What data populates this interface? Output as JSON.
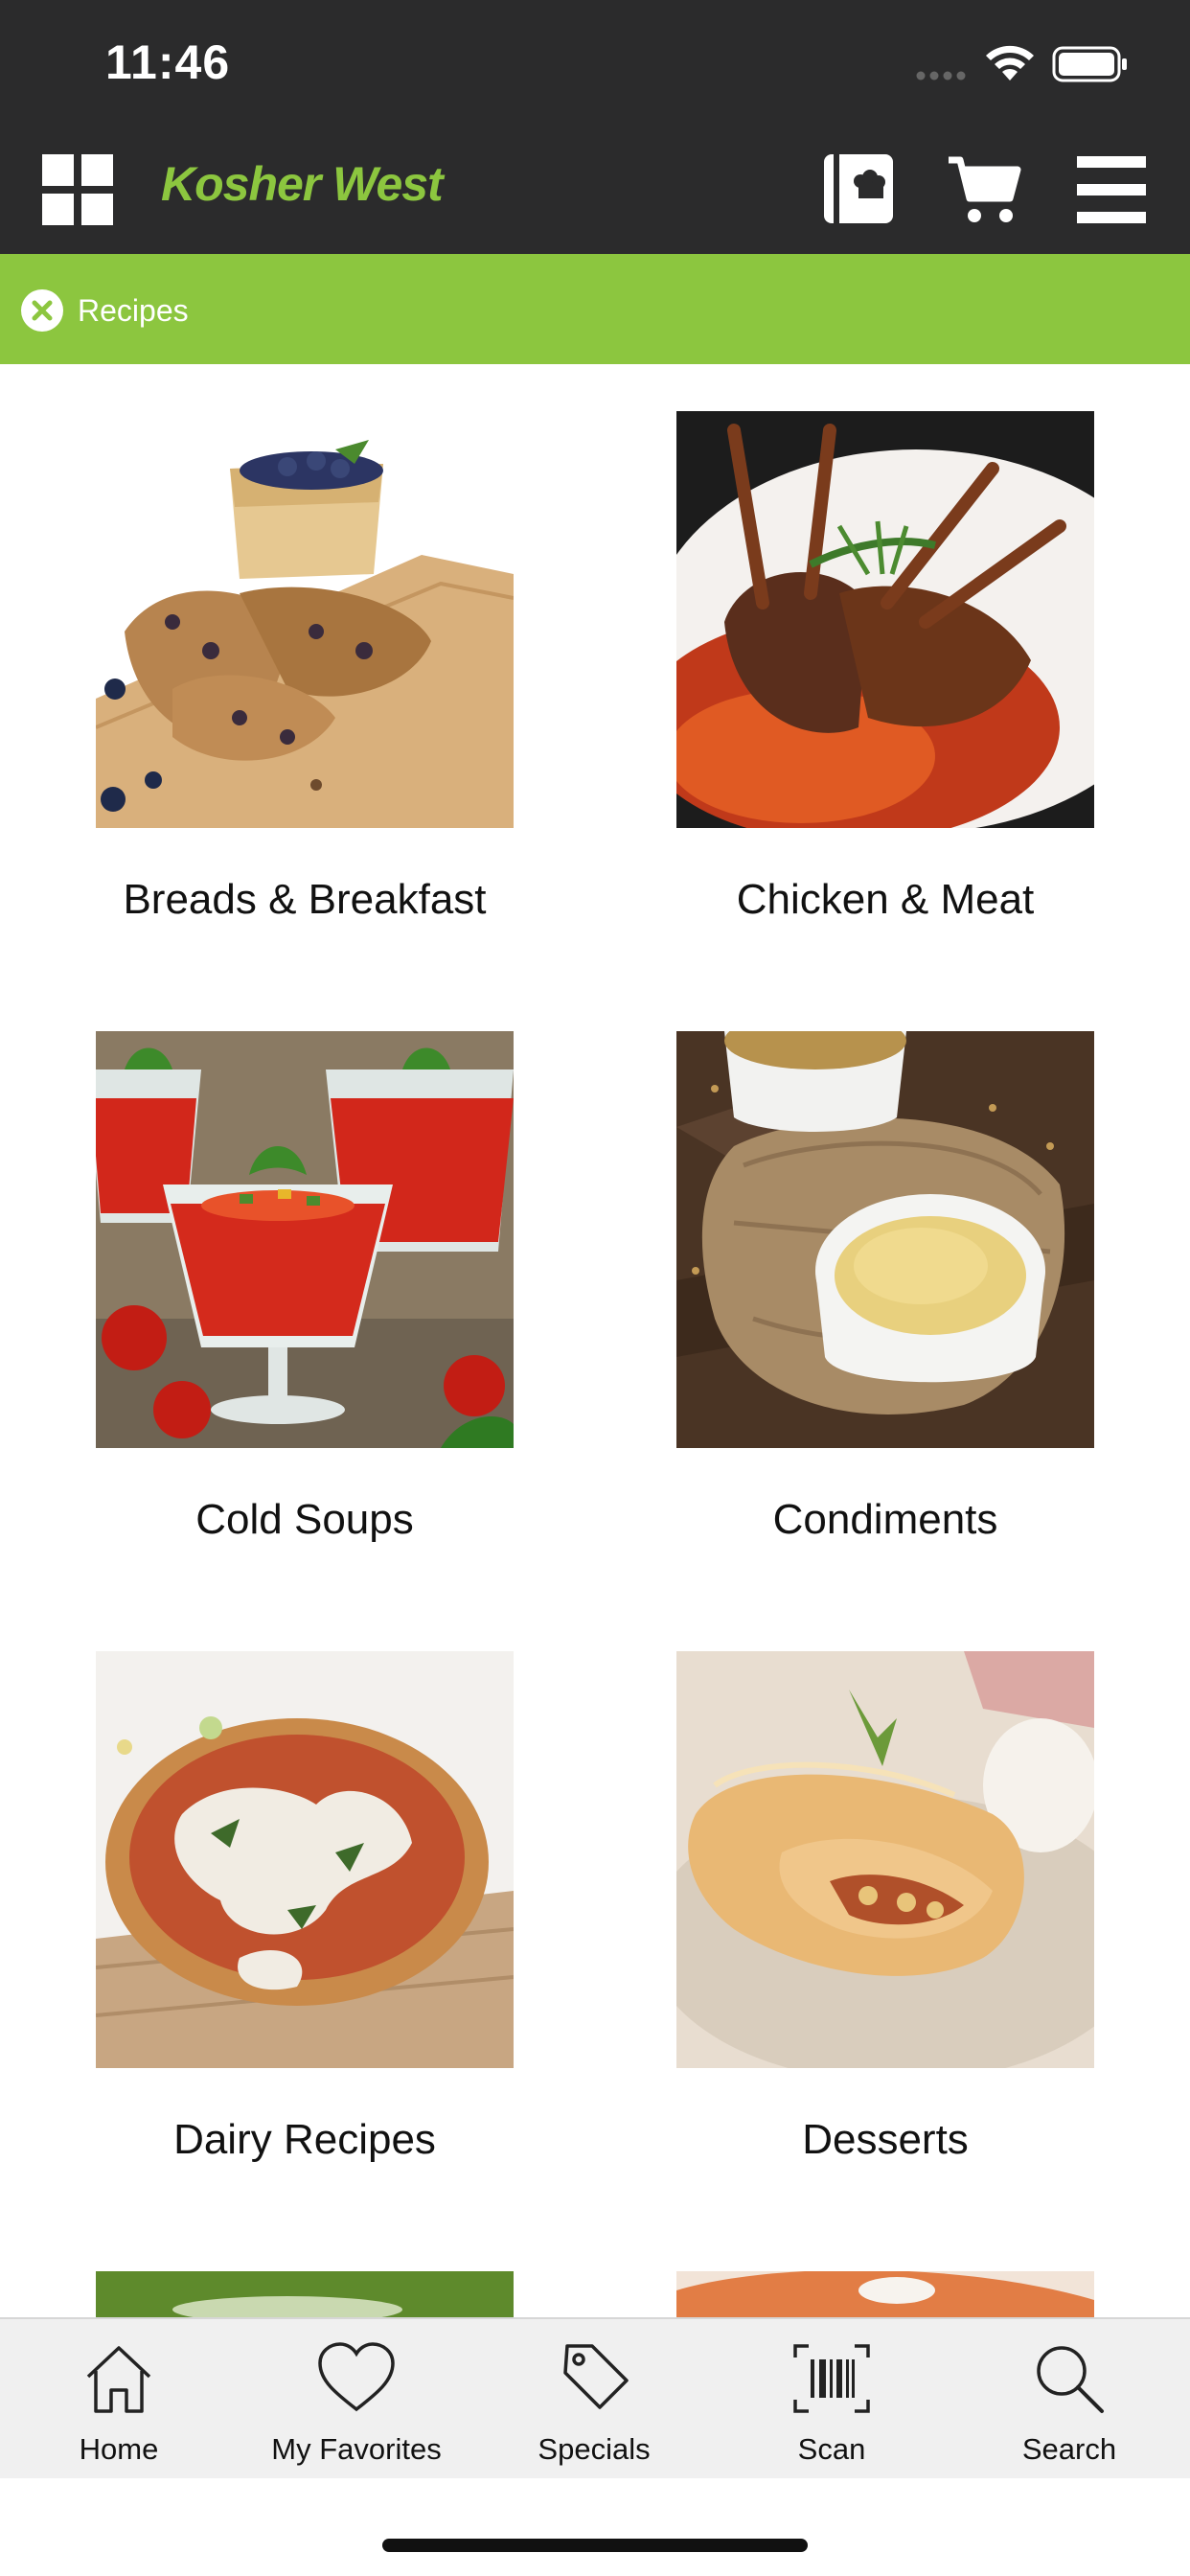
{
  "status_bar": {
    "time": "11:46"
  },
  "header": {
    "logo": "Kosher West"
  },
  "filter": {
    "label": "Recipes"
  },
  "recipes": [
    {
      "label": "Breads & Breakfast"
    },
    {
      "label": "Chicken & Meat"
    },
    {
      "label": "Cold Soups"
    },
    {
      "label": "Condiments"
    },
    {
      "label": "Dairy Recipes"
    },
    {
      "label": "Desserts"
    }
  ],
  "tabs": [
    {
      "label": "Home",
      "icon": "home-icon"
    },
    {
      "label": "My Favorites",
      "icon": "heart-icon"
    },
    {
      "label": "Specials",
      "icon": "tag-icon"
    },
    {
      "label": "Scan",
      "icon": "barcode-icon"
    },
    {
      "label": "Search",
      "icon": "search-icon"
    }
  ],
  "colors": {
    "brand_green": "#8cc63f",
    "header_dark": "#2b2b2c"
  }
}
